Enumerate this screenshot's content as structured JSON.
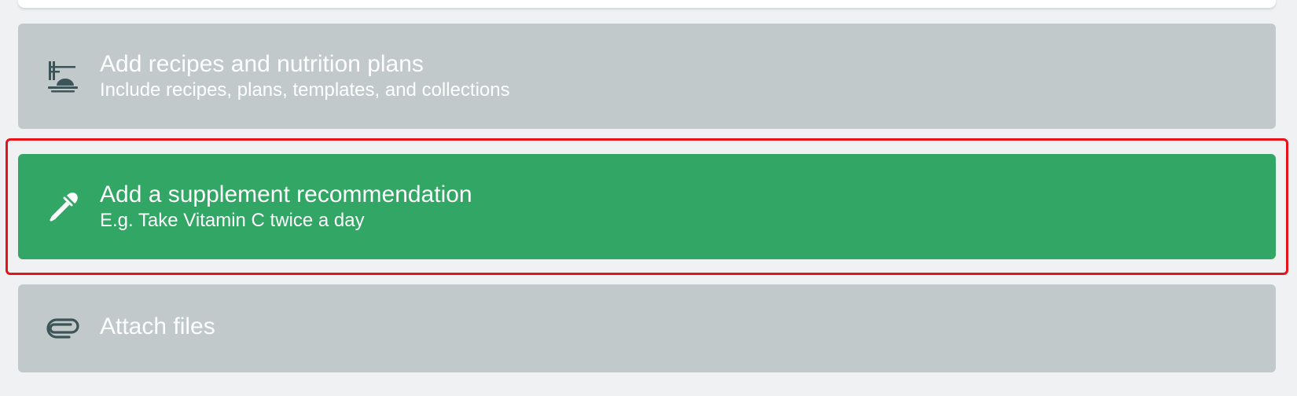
{
  "options": [
    {
      "id": "recipes",
      "title": "Add recipes and nutrition plans",
      "subtitle": "Include recipes, plans, templates, and collections",
      "icon": "recipe-dish-icon",
      "state": "default"
    },
    {
      "id": "supplement",
      "title": "Add a supplement recommendation",
      "subtitle": "E.g. Take Vitamin C twice a day",
      "icon": "dropper-icon",
      "state": "selected"
    },
    {
      "id": "files",
      "title": "Attach files",
      "subtitle": "",
      "icon": "paperclip-icon",
      "state": "default"
    }
  ],
  "colors": {
    "page_background": "#f0f1f3",
    "card_default": "#c1c9ca",
    "card_selected": "#32a664",
    "icon_default": "#3d5558",
    "text": "#ffffff",
    "highlight_border": "#e8131a"
  }
}
